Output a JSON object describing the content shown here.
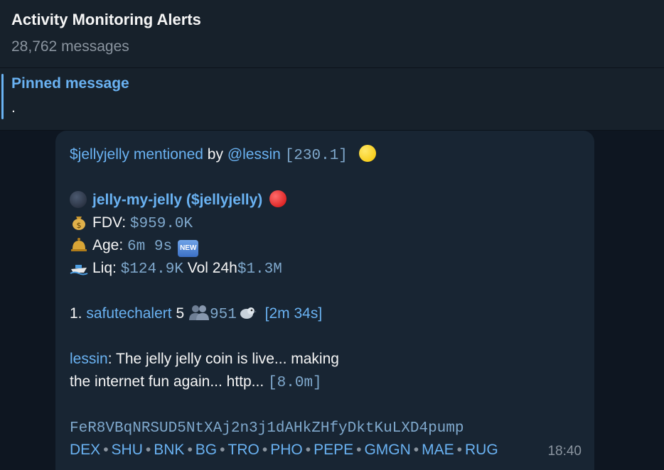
{
  "header": {
    "title": "Activity Monitoring Alerts",
    "subtitle": "28,762 messages"
  },
  "pinned": {
    "title": "Pinned message",
    "text": "."
  },
  "message": {
    "line1": {
      "token": "$jellyjelly",
      "mentioned": "mentioned",
      "by": "by",
      "user": "@lessin",
      "score": "[230.1]"
    },
    "token_name": "jelly-my-jelly ($jellyjelly)",
    "fdv_label": "FDV:",
    "fdv_value": "$959.0K",
    "age_label": "Age:",
    "age_value": "6m  9s",
    "new_badge": "NEW",
    "liq_label": "Liq:",
    "liq_value": "$124.9K",
    "vol_label": "Vol 24h",
    "vol_value": "$1.3M",
    "rank": "1.",
    "channel": "safutechalert",
    "channel_count": "5",
    "members": "951",
    "channel_time": "[2m 34s]",
    "author": "lessin",
    "quote_line1": ": The jelly jelly coin is live... making",
    "quote_line2": "the internet fun again... http...",
    "quote_time": "[8.0m]",
    "address": "FeR8VBqNRSUD5NtXAj2n3j1dAHkZHfyDktKuLXD4pump",
    "links": [
      "DEX",
      "SHU",
      "BNK",
      "BG",
      "TRO",
      "PHO",
      "PEPE",
      "GMGN",
      "MAE",
      "RUG"
    ],
    "separator": "•",
    "timestamp": "18:40"
  },
  "colors": {
    "background": "#0e1621",
    "header_bg": "#17212b",
    "bubble_bg": "#182533",
    "link": "#6ab2f2"
  },
  "icons": [
    "yellow-circle-icon",
    "new-moon-icon",
    "red-circle-icon",
    "money-bag-icon",
    "bell-icon",
    "boat-icon",
    "people-icon",
    "bird-icon",
    "new-badge-icon"
  ]
}
